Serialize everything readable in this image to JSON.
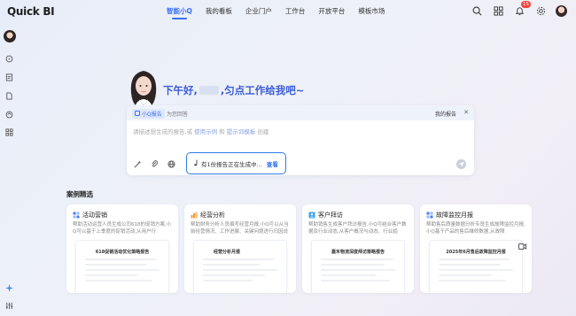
{
  "app": {
    "logo": "Quick BI"
  },
  "nav": [
    {
      "label": "智能小Q",
      "active": true
    },
    {
      "label": "我的看板",
      "active": false
    },
    {
      "label": "企业门户",
      "active": false
    },
    {
      "label": "工作台",
      "active": false
    },
    {
      "label": "开放平台",
      "active": false
    },
    {
      "label": "模板市场",
      "active": false
    }
  ],
  "header": {
    "notification_count": "15"
  },
  "hero": {
    "greeting_prefix": "下午好,",
    "greeting_suffix": ",匀点工作给我吧~"
  },
  "input_card": {
    "tag": "小Q报告",
    "tag_subtitle": "为您回答",
    "my_report": "我的报告",
    "placeholder_a": "请描述想生成的报告,或 ",
    "placeholder_link1": "使用示例",
    "placeholder_b": " 和 ",
    "placeholder_link2": "提示词模板",
    "placeholder_c": " 创建"
  },
  "status": {
    "text": "有1份报告正在生成中...",
    "view_label": "查看"
  },
  "cases": {
    "title": "案例精选",
    "items": [
      {
        "title": "活动营销",
        "desc": "帮助活动运营人员生成公司618的促销方案,小Q可以基于上季度的促销活动,从用户行",
        "preview_title": "618促销活动优化策略报告",
        "icon_color": "#4a7cf0"
      },
      {
        "title": "经营分析",
        "desc": "帮助财务分析人员撰写经营月报,小Q可以从当前经营情况、工作进展、关键问题进行归因说",
        "preview_title": "经营分析月报",
        "icon_color": "#f29a3b"
      },
      {
        "title": "客户拜访",
        "desc": "帮助销售生成客户拜访报告,小Q可结合客户数据及行业动态,从客户概况与动态、行业趋",
        "preview_title": "嘉禾物流深度拜访策略报告",
        "icon_color": "#3aa3f0"
      },
      {
        "title": "故障监控月报",
        "desc": "帮助售后质量数据分析专员生成故障监控月报,小Q基于产品的售后维修数据,从故障",
        "preview_title": "2025年6月售后故障监控月报",
        "icon_color": "#4a7cf0"
      }
    ]
  }
}
